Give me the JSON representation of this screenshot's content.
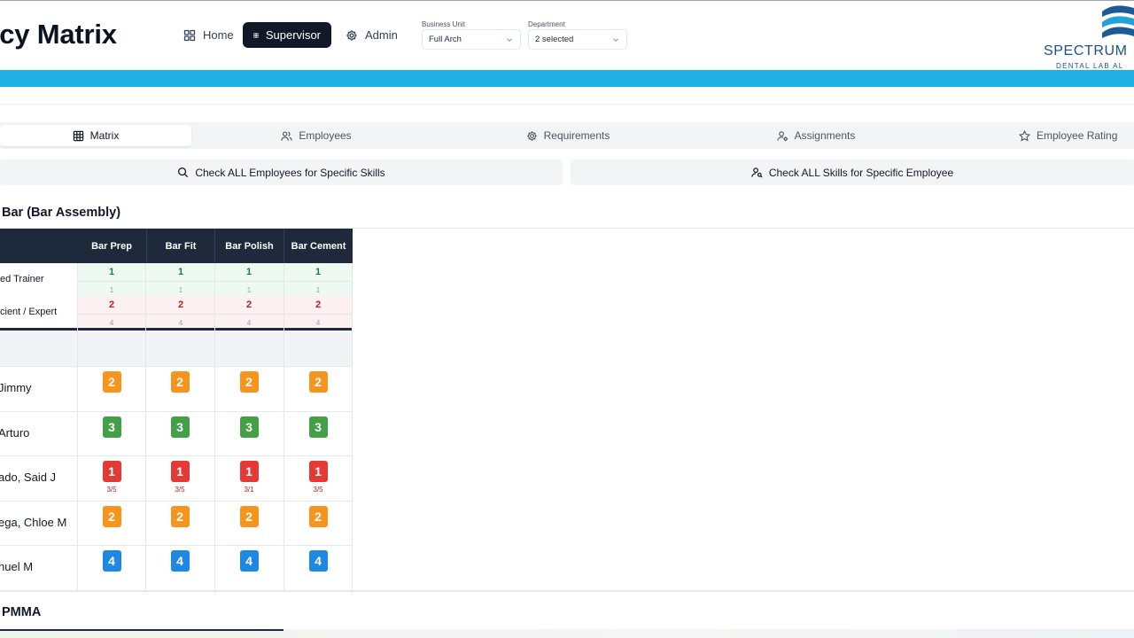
{
  "header": {
    "title": "ciency Matrix",
    "nav": [
      {
        "label": "Home",
        "icon": "grid-icon"
      },
      {
        "label": "Supervisor",
        "icon": "table-icon"
      },
      {
        "label": "Admin",
        "icon": "gear-icon"
      }
    ],
    "active_nav": "Supervisor",
    "filters": {
      "business_unit": {
        "label": "Business Unit",
        "value": "Full Arch"
      },
      "department": {
        "label": "Department",
        "value": "2 selected"
      }
    },
    "logo": {
      "word": "SPECTRUM",
      "sub": "DENTAL LAB AL"
    }
  },
  "colors": {
    "banner": "#1fb0e6",
    "header_dark": "#1e293b",
    "level_1": "#e53935",
    "level_2": "#f7941d",
    "level_3": "#43a047",
    "level_4": "#1e88e5",
    "trainer_row_bg": "#eefaf1",
    "expert_row_bg": "#fdf0f0"
  },
  "tabs": [
    {
      "label": "Matrix",
      "icon": "grid-icon"
    },
    {
      "label": "Employees",
      "icon": "users-icon"
    },
    {
      "label": "Requirements",
      "icon": "gear-icon"
    },
    {
      "label": "Assignments",
      "icon": "user-cog-icon"
    },
    {
      "label": "Employee Rating",
      "icon": "star-icon"
    }
  ],
  "active_tab": "Matrix",
  "actions": [
    {
      "label": "Check ALL Employees for Specific Skills",
      "icon": "search-icon"
    },
    {
      "label": "Check ALL Skills for Specific Employee",
      "icon": "user-search-icon"
    }
  ],
  "section": {
    "title": "Bar (Bar Assembly)",
    "skills": [
      "Bar Prep",
      "Bar Fit",
      "Bar Polish",
      "Bar Cement"
    ],
    "requirements": [
      {
        "label": "ed Trainer",
        "required": [
          "1",
          "1",
          "1",
          "1"
        ],
        "current": [
          "1",
          "1",
          "1",
          "1"
        ]
      },
      {
        "label": "cient / Expert",
        "required": [
          "2",
          "2",
          "2",
          "2"
        ],
        "current": [
          "4",
          "4",
          "4",
          "4"
        ]
      }
    ],
    "employees": [
      {
        "name": "Jimmy",
        "levels": [
          "2",
          "2",
          "2",
          "2"
        ],
        "notes": []
      },
      {
        "name": "Arturo",
        "levels": [
          "3",
          "3",
          "3",
          "3"
        ],
        "notes": []
      },
      {
        "name": "ado, Said J",
        "levels": [
          "1",
          "1",
          "1",
          "1"
        ],
        "notes": [
          "3/5",
          "3/5",
          "3/1",
          "3/5"
        ]
      },
      {
        "name": "ega, Chloe M",
        "levels": [
          "2",
          "2",
          "2",
          "2"
        ],
        "notes": []
      },
      {
        "name": "nuel M",
        "levels": [
          "4",
          "4",
          "4",
          "4"
        ],
        "notes": []
      }
    ]
  },
  "section2": {
    "title": "PMMA"
  }
}
